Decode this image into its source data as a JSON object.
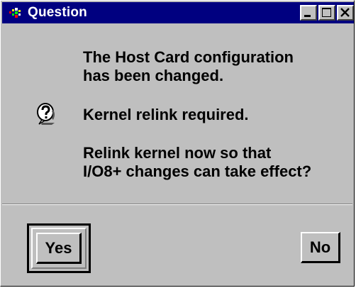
{
  "window": {
    "title": "Question",
    "title_bar_color": "#000080",
    "background_color": "#bfbfbf",
    "title_buttons": [
      "minimize",
      "maximize",
      "close"
    ]
  },
  "message": {
    "icon": "question-icon",
    "line1": "The Host Card configuration",
    "line2": "has been changed.",
    "line3": "Kernel relink required.",
    "line4": "Relink kernel now so that",
    "line5": "I/O8+ changes can take effect?"
  },
  "buttons": {
    "yes_label": "Yes",
    "no_label": "No",
    "default": "yes"
  }
}
